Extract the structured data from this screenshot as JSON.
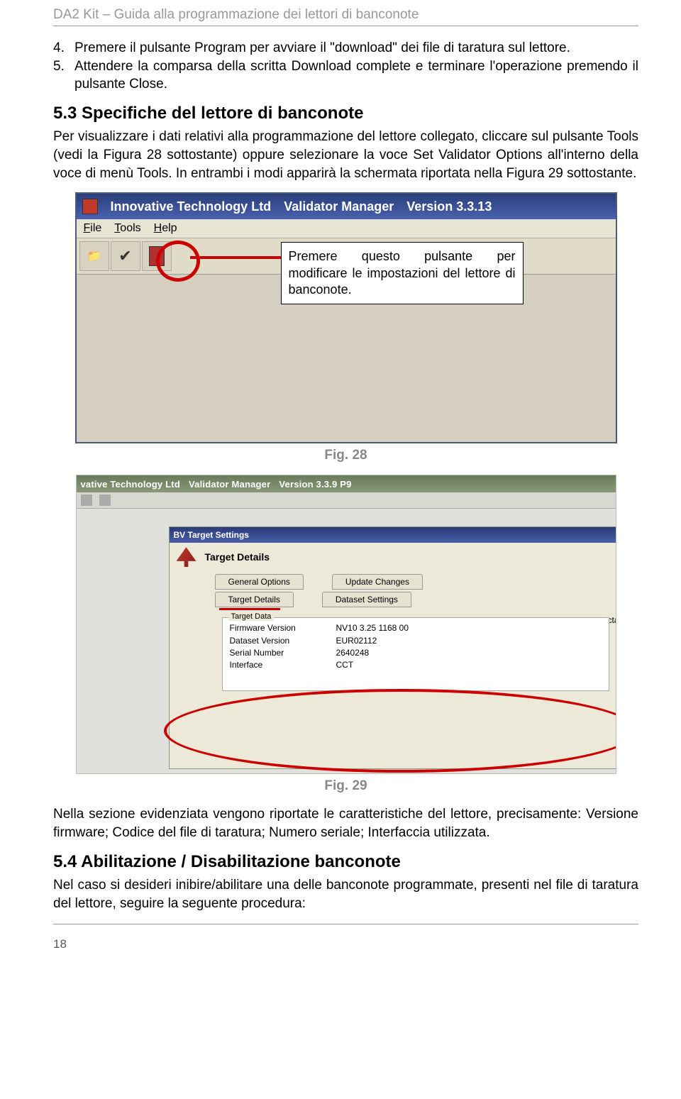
{
  "header": "DA2 Kit – Guida alla programmazione dei lettori di banconote",
  "steps": {
    "s4_num": "4.",
    "s4": "Premere il pulsante Program per avviare il \"download\" dei file di taratura sul lettore.",
    "s5_num": "5.",
    "s5": "Attendere la comparsa della scritta Download complete e terminare l'operazione premendo il pulsante Close."
  },
  "section53_title": "5.3 Specifiche del lettore di banconote",
  "section53_body": "Per visualizzare i dati relativi alla programmazione del lettore collegato, cliccare sul pulsante Tools (vedi la Figura 28 sottostante) oppure selezionare la voce Set Validator Options all'interno della voce di menù Tools. In entrambi i modi apparirà la schermata riportata nella Figura 29 sottostante.",
  "fig28": {
    "title_company": "Innovative Technology Ltd",
    "title_app": "Validator Manager",
    "title_ver": "Version 3.3.13",
    "menu": {
      "file": "File",
      "tools": "Tools",
      "help": "Help"
    },
    "callout": "Premere questo pulsante per modificare le impostazioni del lettore di banconote.",
    "caption": "Fig. 28"
  },
  "fig29": {
    "title_company": "vative Technology Ltd",
    "title_app": "Validator Manager",
    "title_ver": "Version 3.3.9  P9",
    "inner_title": "BV Target Settings",
    "inner_header": "Target Details",
    "tabs": {
      "general": "General Options",
      "update": "Update Changes",
      "target": "Target Details",
      "dataset": "Dataset Settings",
      "ccta": "ccta"
    },
    "panel_label": "Target Data",
    "fields": {
      "fw_k": "Firmware Version",
      "fw_v": "NV10 3.25 1168 00",
      "ds_k": "Dataset Version",
      "ds_v": "EUR02112",
      "sn_k": "Serial Number",
      "sn_v": "2640248",
      "if_k": "Interface",
      "if_v": "CCT"
    },
    "caption": "Fig. 29"
  },
  "para_after": "Nella sezione evidenziata vengono riportate le caratteristiche del lettore, precisamente: Versione firmware; Codice del file di taratura; Numero seriale; Interfaccia utilizzata.",
  "section54_title": "5.4 Abilitazione / Disabilitazione banconote",
  "section54_body": "Nel caso si desideri inibire/abilitare una delle banconote programmate, presenti nel file di taratura del lettore, seguire la seguente procedura:",
  "page_num": "18"
}
